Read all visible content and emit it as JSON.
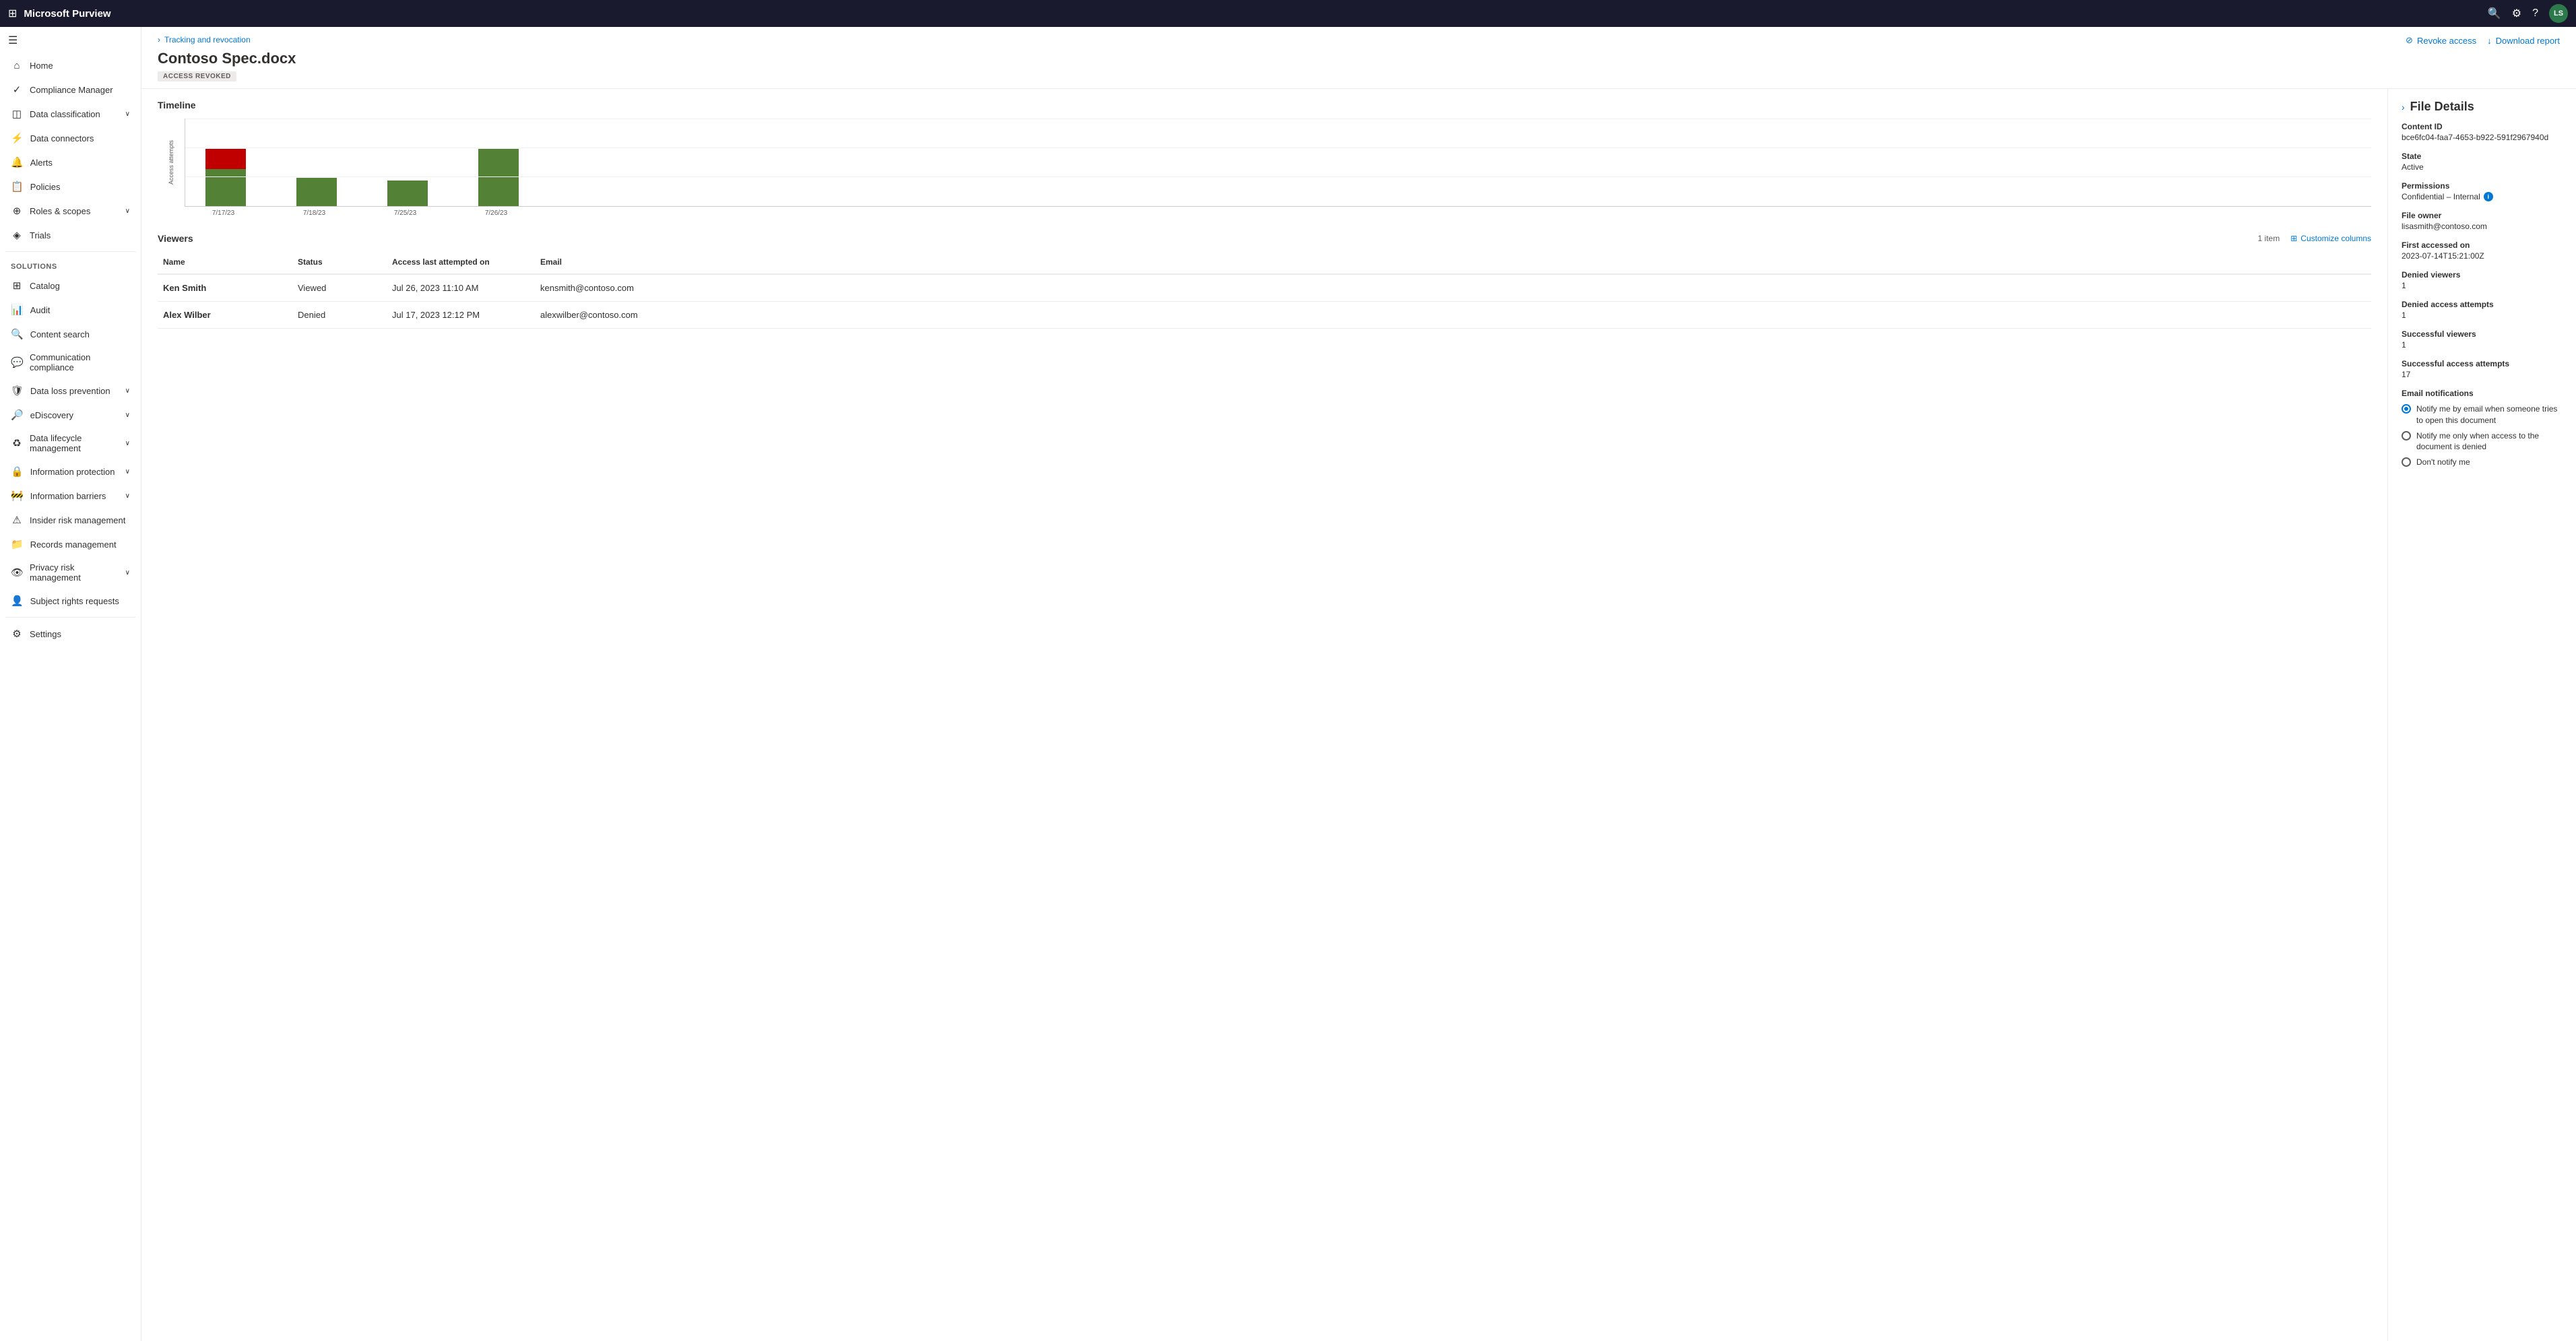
{
  "topbar": {
    "app_title": "Microsoft Purview",
    "avatar_initials": "LS"
  },
  "sidebar": {
    "hamburger_icon": "☰",
    "nav_items": [
      {
        "id": "home",
        "icon": "⌂",
        "label": "Home",
        "active": false,
        "has_chevron": false
      },
      {
        "id": "compliance-manager",
        "icon": "✓",
        "label": "Compliance Manager",
        "active": false,
        "has_chevron": false
      },
      {
        "id": "data-classification",
        "icon": "◫",
        "label": "Data classification",
        "active": false,
        "has_chevron": true
      },
      {
        "id": "data-connectors",
        "icon": "⚡",
        "label": "Data connectors",
        "active": false,
        "has_chevron": false
      },
      {
        "id": "alerts",
        "icon": "🔔",
        "label": "Alerts",
        "active": false,
        "has_chevron": false
      },
      {
        "id": "policies",
        "icon": "📋",
        "label": "Policies",
        "active": false,
        "has_chevron": false
      },
      {
        "id": "roles-scopes",
        "icon": "⊕",
        "label": "Roles & scopes",
        "active": false,
        "has_chevron": true
      },
      {
        "id": "trials",
        "icon": "◈",
        "label": "Trials",
        "active": false,
        "has_chevron": false
      }
    ],
    "solutions_section": "Solutions",
    "solutions_items": [
      {
        "id": "catalog",
        "icon": "⊞",
        "label": "Catalog",
        "has_chevron": false
      },
      {
        "id": "audit",
        "icon": "📊",
        "label": "Audit",
        "has_chevron": false
      },
      {
        "id": "content-search",
        "icon": "🔍",
        "label": "Content search",
        "has_chevron": false
      },
      {
        "id": "communication-compliance",
        "icon": "💬",
        "label": "Communication compliance",
        "has_chevron": false
      },
      {
        "id": "data-loss-prevention",
        "icon": "🛡",
        "label": "Data loss prevention",
        "has_chevron": true
      },
      {
        "id": "ediscovery",
        "icon": "🔎",
        "label": "eDiscovery",
        "has_chevron": true
      },
      {
        "id": "data-lifecycle",
        "icon": "♻",
        "label": "Data lifecycle management",
        "has_chevron": true
      },
      {
        "id": "information-protection",
        "icon": "🔒",
        "label": "Information protection",
        "has_chevron": true
      },
      {
        "id": "information-barriers",
        "icon": "🚧",
        "label": "Information barriers",
        "has_chevron": true
      },
      {
        "id": "insider-risk",
        "icon": "⚠",
        "label": "Insider risk management",
        "has_chevron": false
      },
      {
        "id": "records-management",
        "icon": "📁",
        "label": "Records management",
        "has_chevron": false
      },
      {
        "id": "privacy-risk",
        "icon": "👁",
        "label": "Privacy risk management",
        "has_chevron": true
      },
      {
        "id": "subject-rights",
        "icon": "👤",
        "label": "Subject rights requests",
        "has_chevron": false
      }
    ],
    "settings_label": "Settings"
  },
  "header": {
    "breadcrumb_icon": "›",
    "breadcrumb_text": "Tracking and revocation",
    "page_title": "Contoso Spec.docx",
    "badge_text": "ACCESS REVOKED",
    "revoke_btn": "Revoke access",
    "download_btn": "Download report"
  },
  "timeline": {
    "section_title": "Timeline",
    "y_axis_label": "Access attempts",
    "bars": [
      {
        "date": "7/17/23",
        "green_height": 55,
        "red_height": 30
      },
      {
        "date": "7/18/23",
        "green_height": 42,
        "red_height": 0
      },
      {
        "date": "7/25/23",
        "green_height": 38,
        "red_height": 0
      },
      {
        "date": "7/26/23",
        "green_height": 80,
        "red_height": 0
      }
    ]
  },
  "viewers": {
    "section_title": "Viewers",
    "item_count": "1 item",
    "customize_btn": "Customize columns",
    "columns": [
      "Name",
      "Status",
      "Access last attempted on",
      "Email"
    ],
    "rows": [
      {
        "name": "Ken Smith",
        "status": "Viewed",
        "last_attempted": "Jul 26, 2023 11:10 AM",
        "email": "kensmith@contoso.com"
      },
      {
        "name": "Alex Wilber",
        "status": "Denied",
        "last_attempted": "Jul 17, 2023 12:12 PM",
        "email": "alexwilber@contoso.com"
      }
    ]
  },
  "file_details": {
    "panel_title": "File Details",
    "content_id_label": "Content ID",
    "content_id_value": "bce6fc04-faa7-4653-b922-591f2967940d",
    "state_label": "State",
    "state_value": "Active",
    "permissions_label": "Permissions",
    "permissions_value": "Confidential – Internal",
    "file_owner_label": "File owner",
    "file_owner_value": "lisasmith@contoso.com",
    "first_accessed_label": "First accessed on",
    "first_accessed_value": "2023-07-14T15:21:00Z",
    "denied_viewers_label": "Denied viewers",
    "denied_viewers_value": "1",
    "denied_access_label": "Denied access attempts",
    "denied_access_value": "1",
    "successful_viewers_label": "Successful viewers",
    "successful_viewers_value": "1",
    "successful_access_label": "Successful access attempts",
    "successful_access_value": "17",
    "email_notifications_label": "Email notifications",
    "radio_options": [
      {
        "id": "notify-all",
        "label": "Notify me by email when someone tries to open this document",
        "selected": true
      },
      {
        "id": "notify-denied",
        "label": "Notify me only when access to the document is denied",
        "selected": false
      },
      {
        "id": "no-notify",
        "label": "Don't notify me",
        "selected": false
      }
    ]
  },
  "icons": {
    "hamburger": "☰",
    "home": "⌂",
    "chevron_right": "›",
    "chevron_down": "⌄",
    "revoke": "⊘",
    "download": "↓",
    "customize": "⊞",
    "toggle_panel": "›",
    "info": "i"
  }
}
